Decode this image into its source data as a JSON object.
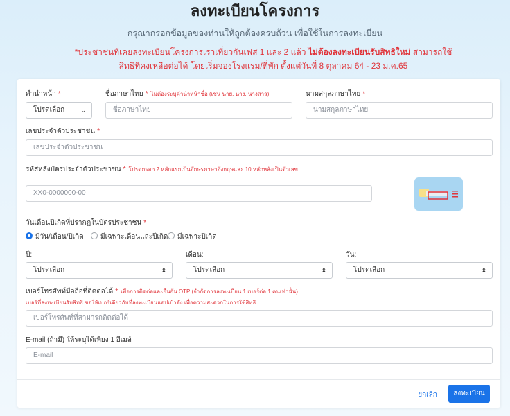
{
  "header": {
    "title": "ลงทะเบียนโครงการ",
    "subtitle": "กรุณากรอกข้อมูลของท่านให้ถูกต้องครบถ้วน เพื่อใช้ในการลงทะเบียน",
    "notice_part1": "*ประชาชนที่เคยลงทะเบียนโครงการเราเที่ยวกันเฟส 1 และ 2 แล้ว ",
    "notice_bold": "ไม่ต้องลงทะเบียนรับสิทธิใหม่",
    "notice_part2": " สามารถใช้สิทธิที่คงเหลือต่อได้ โดยเริ่มจองโรงแรม/ที่พัก ตั้งแต่วันที่ 8 ตุลาคม 64 - 23 ม.ค.65"
  },
  "form": {
    "title_prefix": {
      "label": "คำนำหน้า",
      "req": "*",
      "value": "โปรดเลือก"
    },
    "first_name": {
      "label": "ชื่อภาษาไทย",
      "req": "*",
      "hint": "ไม่ต้องระบุคำนำหน้าชื่อ (เช่น นาย, นาง, นางสาว)",
      "placeholder": "ชื่อภาษาไทย"
    },
    "last_name": {
      "label": "นามสกุลภาษาไทย",
      "req": "*",
      "placeholder": "นามสกุลภาษาไทย"
    },
    "citizen_id": {
      "label": "เลขประจำตัวประชาชน",
      "req": "*",
      "placeholder": "เลขประจำตัวประชาชน"
    },
    "laser_code": {
      "label": "รหัสหลังบัตรประจำตัวประชาชน",
      "req": "*",
      "hint": "โปรดกรอก 2 หลักแรกเป็นอักษรภาษาอังกฤษและ 10 หลักหลังเป็นตัวเลข",
      "placeholder": "XX0-0000000-00"
    },
    "birth": {
      "label": "วันเดือนปีเกิดที่ปรากฏในบัตรประชาชน",
      "req": "*",
      "options": [
        "มีวัน/เดือน/ปีเกิด",
        "มีเฉพาะเดือนและปีเกิด",
        "มีเฉพาะปีเกิด"
      ],
      "selected": "มีวัน/เดือน/ปีเกิด",
      "year_label": "ปี:",
      "month_label": "เดือน:",
      "day_label": "วัน:",
      "select_value": "โปรดเลือก"
    },
    "phone": {
      "label": "เบอร์โทรศัพท์มือถือที่ติดต่อได้",
      "req": "*",
      "hint": "เพื่อการติดต่อและยืนยัน OTP (จำกัดการลงทะเบียน 1 เบอร์ต่อ 1 คนเท่านั้น)",
      "hint2": "เบอร์ที่ลงทะเบียนรับสิทธิ ขอให้เบอร์เดียวกับที่ลงทะเบียนแอปเป๋าตัง เพื่อความสะดวกในการใช้สิทธิ",
      "placeholder": "เบอร์โทรศัพท์ที่สามารถติดต่อได้"
    },
    "email": {
      "label": "E-mail (ถ้ามี) ให้ระบุได้เพียง 1 อีเมล์",
      "placeholder": "E-mail"
    }
  },
  "actions": {
    "cancel": "ยกเลิก",
    "submit": "ลงทะเบียน"
  },
  "colors": {
    "accent": "#1a73e8",
    "warning": "#e0343a",
    "card_frame": "#e0343a"
  }
}
